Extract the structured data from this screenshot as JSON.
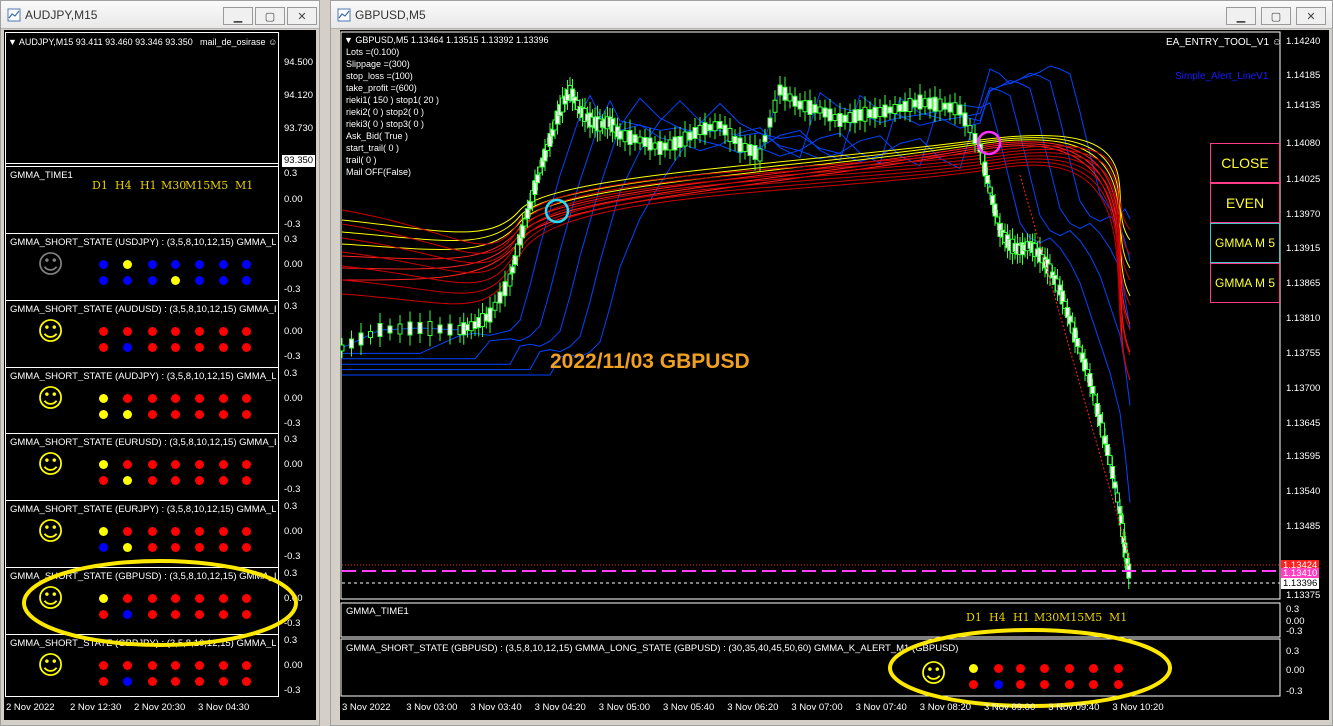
{
  "left_window": {
    "title": "AUDJPY,M15",
    "info_line": "AUDJPY,M15  93.411 93.460 93.346 93.350",
    "ea_label": "mail_de_osirase",
    "price_axis": [
      "94.500",
      "94.120",
      "93.730"
    ],
    "current_price": "93.350",
    "time_axis": [
      "2 Nov 2022",
      "2 Nov 12:30",
      "2 Nov 20:30",
      "3 Nov 04:30"
    ],
    "time_panel": {
      "title": "GMMA_TIME1",
      "timeframes": [
        "D1",
        "H4",
        "H1",
        "M30",
        "M15",
        "M5",
        "M1"
      ],
      "scale": [
        "0.3",
        "0.00",
        "-0.3"
      ]
    },
    "panels": [
      {
        "title": "GMMA_SHORT_STATE (USDJPY) : (3,5,8,10,12,15)  GMMA_L",
        "smiley": "gray",
        "row1": [
          "blue",
          "yellow",
          "blue",
          "blue",
          "blue",
          "blue",
          "blue"
        ],
        "row2": [
          "blue",
          "blue",
          "blue",
          "yellow",
          "blue",
          "blue",
          "blue"
        ]
      },
      {
        "title": "GMMA_SHORT_STATE (AUDUSD) : (3,5,8,10,12,15)  GMMA_L",
        "smiley": "yellow",
        "row1": [
          "red",
          "red",
          "red",
          "red",
          "red",
          "red",
          "red"
        ],
        "row2": [
          "red",
          "blue",
          "red",
          "red",
          "red",
          "red",
          "red"
        ]
      },
      {
        "title": "GMMA_SHORT_STATE (AUDJPY) : (3,5,8,10,12,15)  GMMA_L",
        "smiley": "yellow",
        "row1": [
          "yellow",
          "red",
          "red",
          "red",
          "red",
          "red",
          "red"
        ],
        "row2": [
          "yellow",
          "yellow",
          "red",
          "red",
          "red",
          "red",
          "red"
        ]
      },
      {
        "title": "GMMA_SHORT_STATE (EURUSD) : (3,5,8,10,12,15)  GMMA_L",
        "smiley": "yellow",
        "row1": [
          "yellow",
          "red",
          "red",
          "red",
          "red",
          "red",
          "red"
        ],
        "row2": [
          "red",
          "yellow",
          "red",
          "red",
          "red",
          "red",
          "red"
        ]
      },
      {
        "title": "GMMA_SHORT_STATE (EURJPY) : (3,5,8,10,12,15)  GMMA_L",
        "smiley": "yellow",
        "row1": [
          "yellow",
          "red",
          "red",
          "red",
          "red",
          "red",
          "red"
        ],
        "row2": [
          "blue",
          "yellow",
          "red",
          "red",
          "red",
          "red",
          "red"
        ]
      },
      {
        "title": "GMMA_SHORT_STATE (GBPUSD) : (3,5,8,10,12,15)  GMMA_L",
        "smiley": "yellow",
        "row1": [
          "yellow",
          "red",
          "red",
          "red",
          "red",
          "red",
          "red"
        ],
        "row2": [
          "red",
          "blue",
          "red",
          "red",
          "red",
          "red",
          "red"
        ]
      },
      {
        "title": "GMMA_SHORT_STATE (GBPJPY) : (3,5,8,10,12,15)  GMMA_L",
        "smiley": "yellow",
        "row1": [
          "red",
          "red",
          "red",
          "red",
          "red",
          "red",
          "red"
        ],
        "row2": [
          "red",
          "blue",
          "red",
          "red",
          "red",
          "red",
          "red"
        ]
      }
    ],
    "panel_scale": [
      "0.3",
      "0.00",
      "-0.3"
    ]
  },
  "right_window": {
    "title": "GBPUSD,M5",
    "info_line": "GBPUSD,M5  1.13464 1.13515 1.13392 1.13396",
    "ea_label": "EA_ENTRY_TOOL_V1",
    "alert_label": "Simple_Alert_LineV1",
    "params": [
      "Lots =(0.100)",
      "Slippage =(300)",
      "stop_loss =(100)",
      "take_profit =(600)",
      "rieki1( 150 ) stop1( 20 )",
      "rieki2( 0 ) stop2( 0 )",
      "rieki3( 0 ) stop3( 0 )",
      "Ask_Bid( True )",
      "start_trail( 0 )",
      "trail( 0 )",
      "Mail OFF(False)"
    ],
    "annotation": "2022/11/03 GBPUSD",
    "price_axis": [
      "1.14240",
      "1.14185",
      "1.14135",
      "1.14080",
      "1.14025",
      "1.13970",
      "1.13915",
      "1.13865",
      "1.13810",
      "1.13755",
      "1.13700",
      "1.13645",
      "1.13595",
      "1.13540",
      "1.13485",
      "1.13375"
    ],
    "price_red": "1.13424",
    "price_pink": "1.13410",
    "price_current": "1.13396",
    "buttons": {
      "close": "CLOSE",
      "even": "EVEN",
      "gmma1": "GMMA M 5",
      "gmma2": "GMMA M 5"
    },
    "time_panel": {
      "title": "GMMA_TIME1",
      "timeframes": [
        "D1",
        "H4",
        "H1",
        "M30",
        "M15",
        "M5",
        "M1"
      ],
      "scale": [
        "0.3",
        "0.00",
        "-0.3"
      ]
    },
    "state_panel": {
      "title": "GMMA_SHORT_STATE (GBPUSD) : (3,5,8,10,12,15)  GMMA_LONG_STATE (GBPUSD) : (30,35,40,45,50,60)  GMMA_K_ALERT_M1 (GBPUSD)",
      "scale": [
        "0.3",
        "0.00",
        "-0.3"
      ],
      "row1": [
        "yellow",
        "red",
        "red",
        "red",
        "red",
        "red",
        "red"
      ],
      "row2": [
        "red",
        "blue",
        "red",
        "red",
        "red",
        "red",
        "red"
      ]
    },
    "time_axis": [
      "3 Nov 2022",
      "3 Nov 03:00",
      "3 Nov 03:40",
      "3 Nov 04:20",
      "3 Nov 05:00",
      "3 Nov 05:40",
      "3 Nov 06:20",
      "3 Nov 07:00",
      "3 Nov 07:40",
      "3 Nov 08:20",
      "3 Nov 09:00",
      "3 Nov 09:40",
      "3 Nov 10:20"
    ]
  },
  "colors": {
    "red": "#ff0000",
    "yellow": "#ffff00",
    "blue": "#0000ff",
    "gray": "#808080",
    "annotation": "#f0a020",
    "highlight": "#ffe800"
  }
}
